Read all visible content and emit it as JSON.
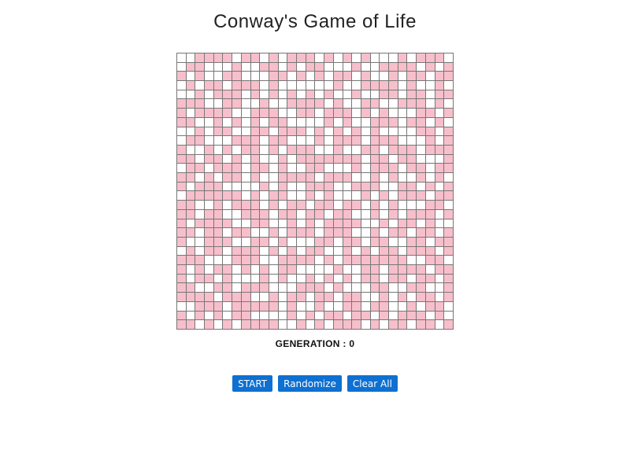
{
  "title": "Conway's Game of Life",
  "generation_label": "GENERATION : ",
  "generation": "0",
  "buttons": {
    "start": "START",
    "randomize": "Randomize",
    "clear": "Clear All"
  },
  "colors": {
    "alive": "#f7bfcb",
    "dead": "#ffffff",
    "grid_line": "#777777",
    "button": "#0e70d1"
  },
  "grid": {
    "rows": 30,
    "cols": 30,
    "cells": [
      "001111011010111010101000101110",
      "011000100110101100010011110101",
      "101001100011010101101001011011",
      "010110111010000001001111010010",
      "001011101010101010010011011011",
      "111001100100111101001100111010",
      "101111001110011011101010001101",
      "110010101011000010100111011010",
      "001011001101110101010100001101",
      "011000111011000101110111000101",
      "100101011010111001001101110111",
      "110110101001011111110110110001",
      "011011101101001100010111011011",
      "110101101001111011100101001010",
      "101110000101001110011100110101",
      "011111101011001010001010111011",
      "110010111010110110110101000110",
      "110110011101101101100101011101",
      "101111001100101011110010110100",
      "110110110010111011100101101101",
      "100111001101000110110110011011",
      "010110111010101100101011011101",
      "111000111001111010111111100110",
      "101011010101100001001101111011",
      "101101000101001010101101101101",
      "110011011100011101000110011001",
      "111101110010110110110010101101",
      "001110111110100100110110010110",
      "101010110000101011011010111010",
      "110101011110010101110101101101"
    ]
  }
}
